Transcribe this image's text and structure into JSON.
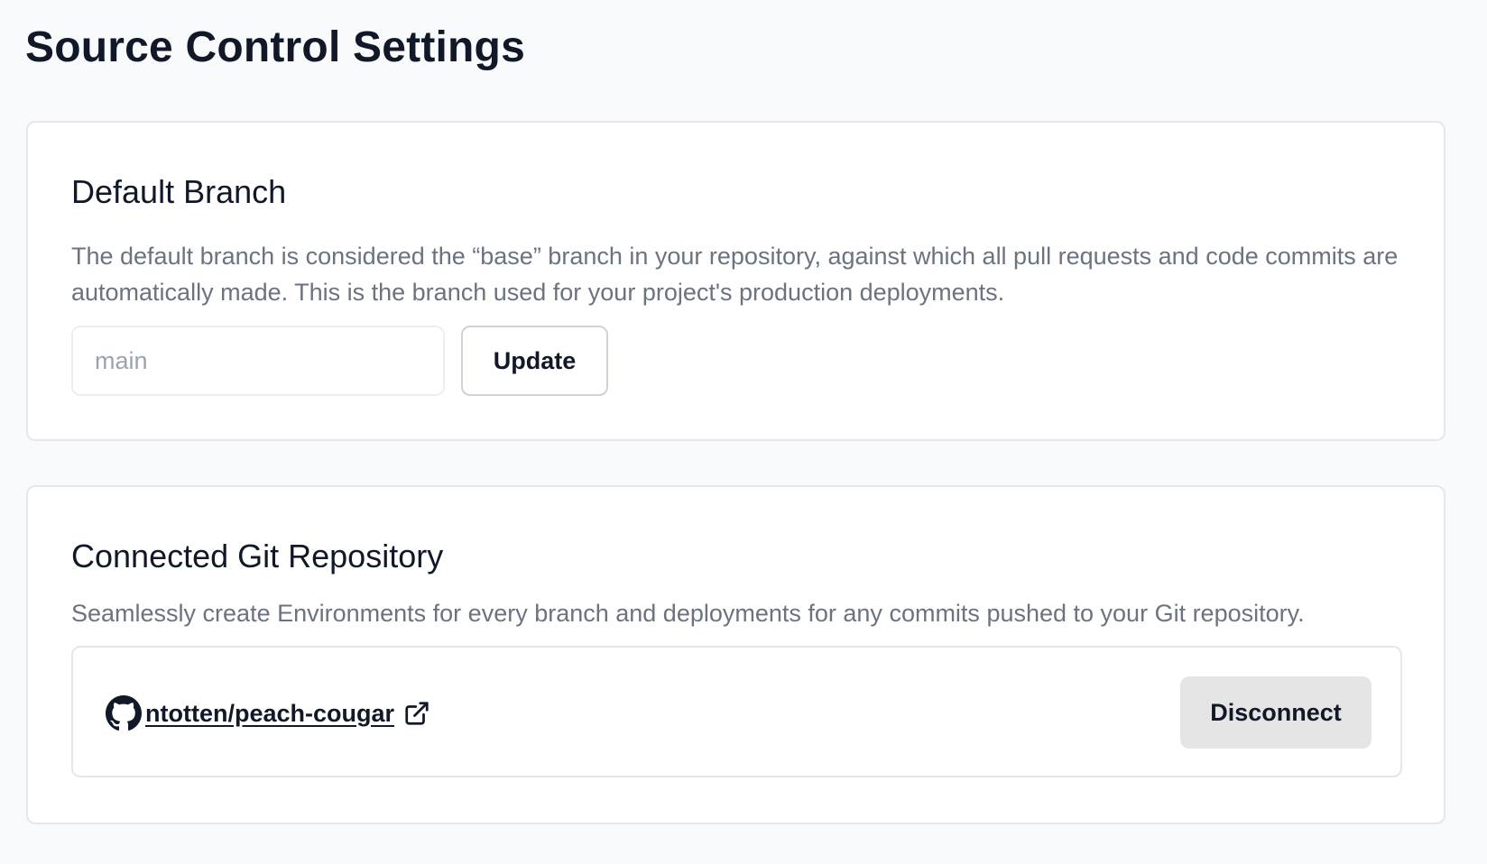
{
  "page": {
    "title": "Source Control Settings"
  },
  "default_branch": {
    "title": "Default Branch",
    "description": "The default branch is considered the “base” branch in your repository, against which all pull requests and code commits are automatically made. This is the branch used for your project's production deployments.",
    "input": {
      "value": "",
      "placeholder": "main"
    },
    "update_label": "Update"
  },
  "git_repository": {
    "title": "Connected Git Repository",
    "description": "Seamlessly create Environments for every branch and deployments for any commits pushed to your Git repository.",
    "repo_name": "ntotten/peach-cougar",
    "repo_icon": "github-icon",
    "external_link_icon": "external-link-icon",
    "disconnect_label": "Disconnect"
  }
}
